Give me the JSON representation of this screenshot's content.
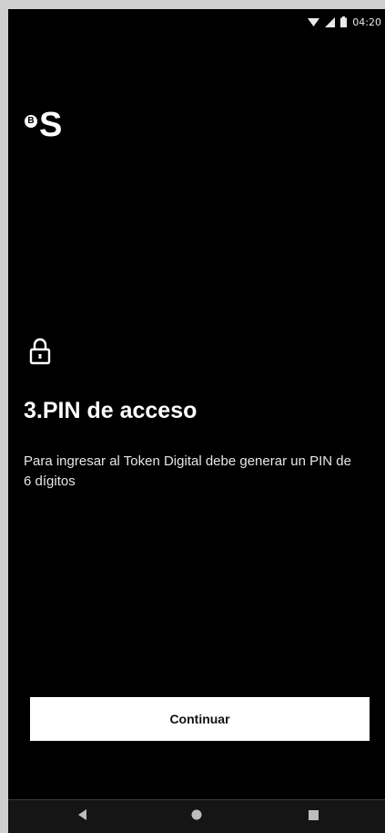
{
  "status_bar": {
    "time": "04:20",
    "icons": [
      "wifi-icon",
      "signal-icon",
      "battery-icon"
    ]
  },
  "logo": {
    "badge_letter": "B",
    "letter": "S"
  },
  "content": {
    "icon": "lock-icon",
    "title": "3.PIN de acceso",
    "description": "Para ingresar al Token Digital debe generar un PIN de 6 dígitos"
  },
  "actions": {
    "continue_label": "Continuar"
  },
  "nav_bar": {
    "buttons": [
      "back-icon",
      "home-icon",
      "recents-icon"
    ]
  },
  "colors": {
    "background": "#000000",
    "text": "#ffffff",
    "button_bg": "#ffffff",
    "button_text": "#111111"
  }
}
